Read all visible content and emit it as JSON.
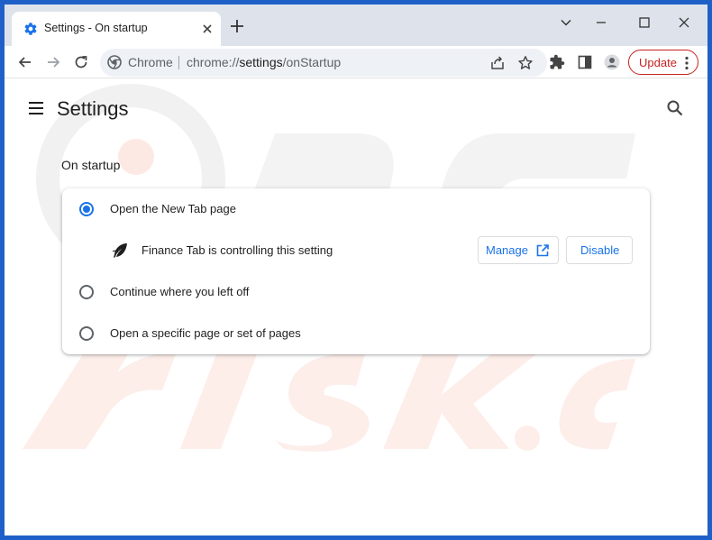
{
  "tab": {
    "title": "Settings - On startup",
    "favicon": "settings-gear-icon",
    "close_icon": "close-icon"
  },
  "new_tab_icon": "plus-icon",
  "window_controls": [
    "chevron-down-icon",
    "minimize-icon",
    "maximize-icon",
    "close-icon"
  ],
  "toolbar": {
    "back_icon": "back-arrow-icon",
    "forward_icon": "forward-arrow-icon",
    "reload_icon": "reload-icon",
    "omnibox": {
      "chip": "Chrome",
      "url_prefix": "chrome://",
      "url_host": "settings",
      "url_path": "/onStartup"
    },
    "share_icon": "share-icon",
    "bookmark_icon": "star-icon",
    "extensions_icon": "puzzle-icon",
    "side_panel_icon": "side-panel-icon",
    "profile_icon": "avatar-icon",
    "update_label": "Update",
    "menu_icon": "kebab-menu-icon"
  },
  "page": {
    "title": "Settings",
    "section_title": "On startup",
    "options": [
      {
        "label": "Open the New Tab page",
        "checked": true
      },
      {
        "label": "Continue where you left off",
        "checked": false
      },
      {
        "label": "Open a specific page or set of pages",
        "checked": false
      }
    ],
    "extension_notice": {
      "text": "Finance Tab is controlling this setting",
      "manage_label": "Manage",
      "disable_label": "Disable"
    }
  },
  "colors": {
    "accent": "#1a73e8",
    "update_red": "#c5221f",
    "frame": "#dee3eb",
    "window_border": "#1e60c8"
  }
}
